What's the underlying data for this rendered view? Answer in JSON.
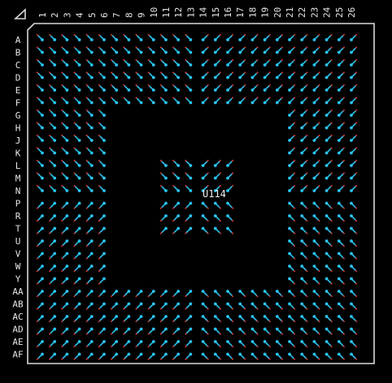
{
  "view": {
    "background": "#000000",
    "outline_color": "#d8d8d8",
    "pad_color": "#29c4f0",
    "trace_color": "#d23a3a",
    "marker_icon": "pin1-triangle-icon"
  },
  "package": {
    "ref_designator": "U114",
    "columns": [
      "1",
      "2",
      "3",
      "4",
      "5",
      "6",
      "7",
      "8",
      "9",
      "10",
      "11",
      "12",
      "13",
      "14",
      "15",
      "16",
      "17",
      "18",
      "19",
      "20",
      "21",
      "22",
      "23",
      "24",
      "25",
      "26"
    ],
    "rows": [
      "A",
      "B",
      "C",
      "D",
      "E",
      "F",
      "G",
      "H",
      "J",
      "K",
      "L",
      "M",
      "N",
      "P",
      "R",
      "T",
      "U",
      "V",
      "W",
      "Y",
      "AA",
      "AB",
      "AC",
      "AD",
      "AE",
      "AF"
    ],
    "outer_rows_depth": 6,
    "inner_block": {
      "from_index": 10,
      "to_index": 15
    }
  }
}
